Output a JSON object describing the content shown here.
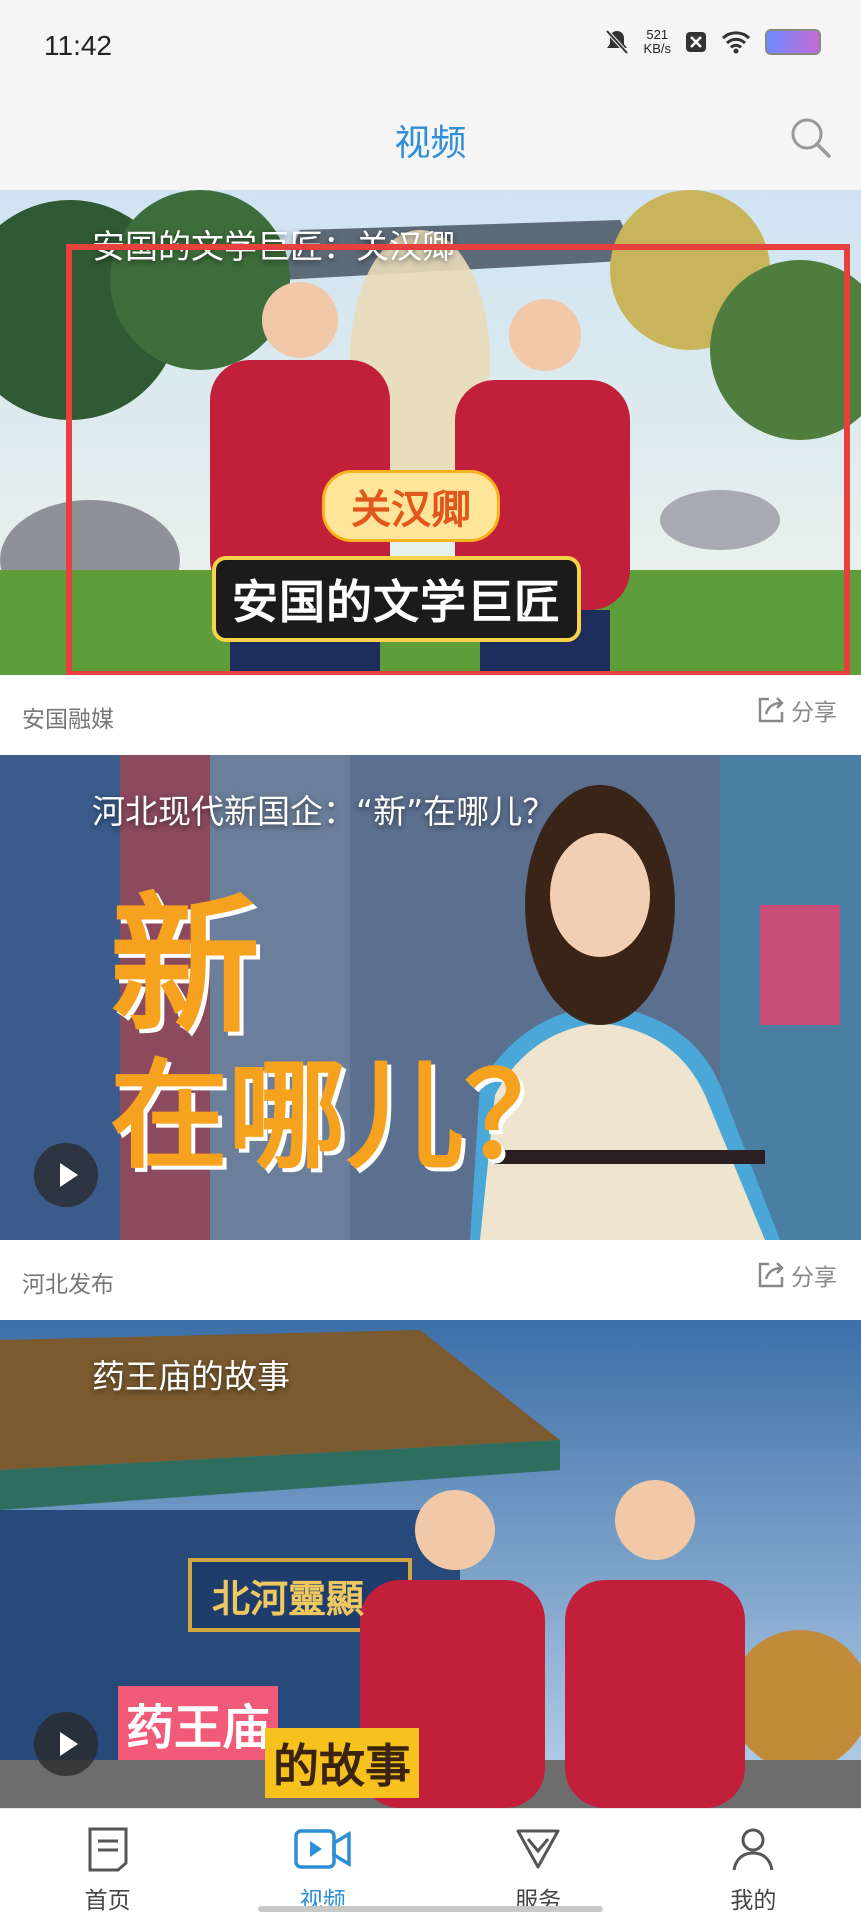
{
  "status_bar": {
    "time": "11:42",
    "net_speed_value": "521",
    "net_speed_unit": "KB/s",
    "icons": [
      "mute-icon",
      "data-off-icon",
      "wifi-icon",
      "battery-icon"
    ]
  },
  "header": {
    "title": "视频",
    "search_icon": "search-icon"
  },
  "videos": [
    {
      "title": "安国的文学巨匠：关汉卿",
      "overlay_tag": "关汉卿",
      "overlay_caption": "安国的文学巨匠",
      "source": "安国融媒",
      "share_label": "分享"
    },
    {
      "title": "河北现代新国企：“新”在哪儿？",
      "overlay_caption_line1": "新",
      "overlay_caption_line2": "在哪儿？",
      "source": "河北发布",
      "share_label": "分享"
    },
    {
      "title": "药王庙的故事",
      "overlay_caption_line1": "药王庙",
      "overlay_caption_line2": "的故事",
      "sign_text": "北河靈顯"
    }
  ],
  "bottom_nav": [
    {
      "label": "首页",
      "icon": "home-doc-icon"
    },
    {
      "label": "视频",
      "icon": "video-icon",
      "active": true
    },
    {
      "label": "服务",
      "icon": "service-icon"
    },
    {
      "label": "我的",
      "icon": "profile-icon"
    }
  ],
  "colors": {
    "accent": "#2d8fd6",
    "highlight_box": "#e8413d",
    "caption_yellow": "#f7b21e"
  }
}
